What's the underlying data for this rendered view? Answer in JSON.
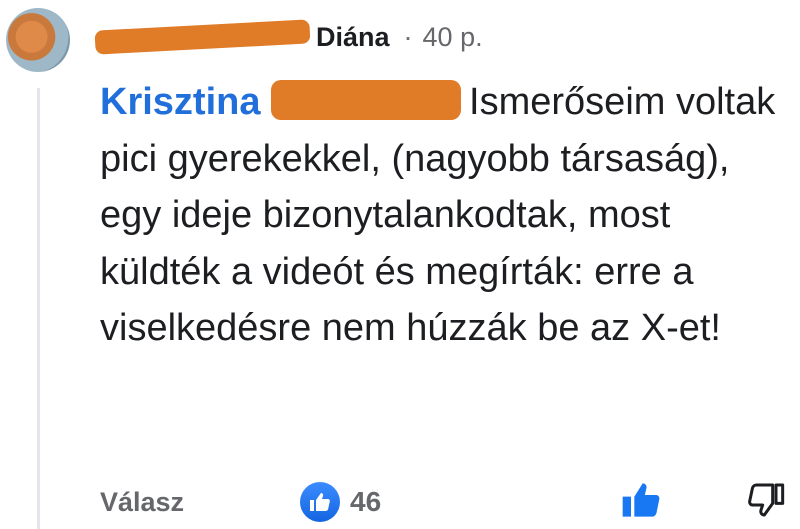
{
  "comment": {
    "author_visible_part": "Diána",
    "time": "40 p.",
    "separator": "·",
    "mention_visible_part": "Krisztina",
    "text": "Ismerőseim voltak pici gyerekekkel, (nagyobb társaság), egy ideje bizonytalankodtak, most küldték a videót és megírták: erre a viselkedésre nem húzzák be az X-et!"
  },
  "footer": {
    "reply_label": "Válasz",
    "like_count": "46"
  },
  "icons": {
    "avatar": "avatar",
    "reaction": "like-reaction-icon",
    "like": "thumbs-up-icon",
    "dislike": "thumbs-down-icon"
  },
  "colors": {
    "mention": "#216fdb",
    "redaction": "#e07b28",
    "muted": "#65676b",
    "like_blue": "#1877f2"
  }
}
